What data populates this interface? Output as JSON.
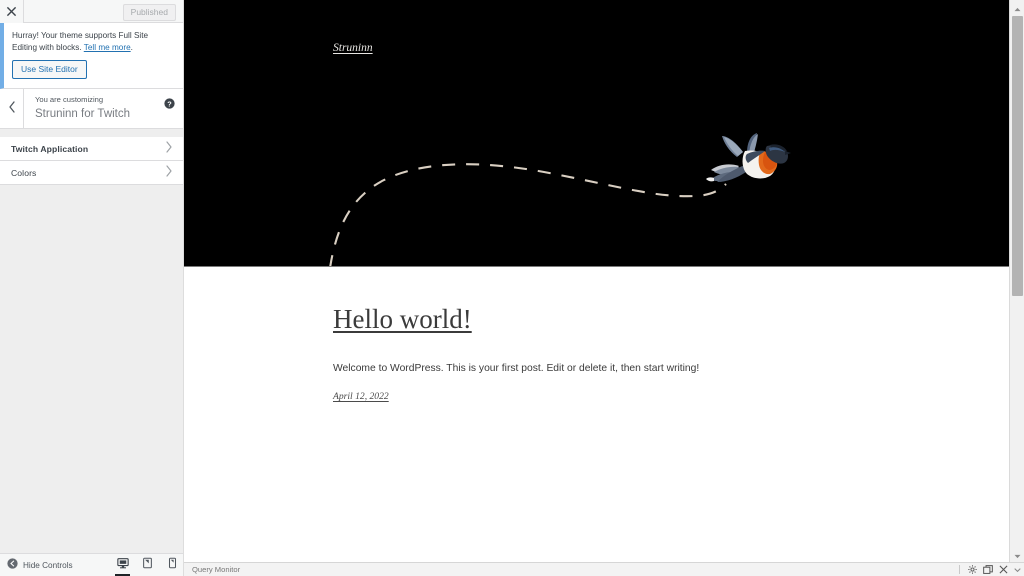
{
  "customizer": {
    "close_icon": "close-x-icon",
    "publish_button_label": "Published",
    "notice": {
      "text_before": "Hurray! Your theme supports Full Site Editing with blocks. ",
      "link_label": "Tell me more",
      "text_after": ".",
      "button_label": "Use Site Editor",
      "accent_color": "#72aee6"
    },
    "back_icon": "chevron-left-icon",
    "customizing_label": "You are customizing",
    "customizing_title": "Struninn for Twitch",
    "help_icon": "help-circle-icon",
    "panels": [
      {
        "label": "Twitch Application",
        "icon": "chevron-right-icon"
      },
      {
        "label": "Colors",
        "icon": "chevron-right-icon"
      }
    ],
    "footer": {
      "hide_controls_label": "Hide Controls",
      "hide_controls_icon": "collapse-circle-icon",
      "devices": [
        {
          "name": "desktop",
          "icon": "desktop-icon",
          "active": true
        },
        {
          "name": "tablet",
          "icon": "tablet-icon",
          "active": false
        },
        {
          "name": "mobile",
          "icon": "mobile-icon",
          "active": false
        }
      ]
    }
  },
  "preview": {
    "site_title": "Struninn",
    "hero_background_color": "#000000",
    "hero_trail_color": "#d9cfc2",
    "hero_image_name": "flying-swallow-bird",
    "post": {
      "title": "Hello world!",
      "body": "Welcome to WordPress. This is your first post. Edit or delete it, then start writing!",
      "date": "April 12, 2022"
    },
    "scrollbar": {
      "up_icon": "scroll-up-arrow-icon",
      "down_icon": "scroll-down-arrow-icon"
    }
  },
  "query_monitor": {
    "label": "Query Monitor",
    "icons": [
      {
        "name": "settings-gear-icon"
      },
      {
        "name": "dock-panel-icon"
      },
      {
        "name": "close-x-icon"
      },
      {
        "name": "chevron-down-icon"
      }
    ]
  }
}
